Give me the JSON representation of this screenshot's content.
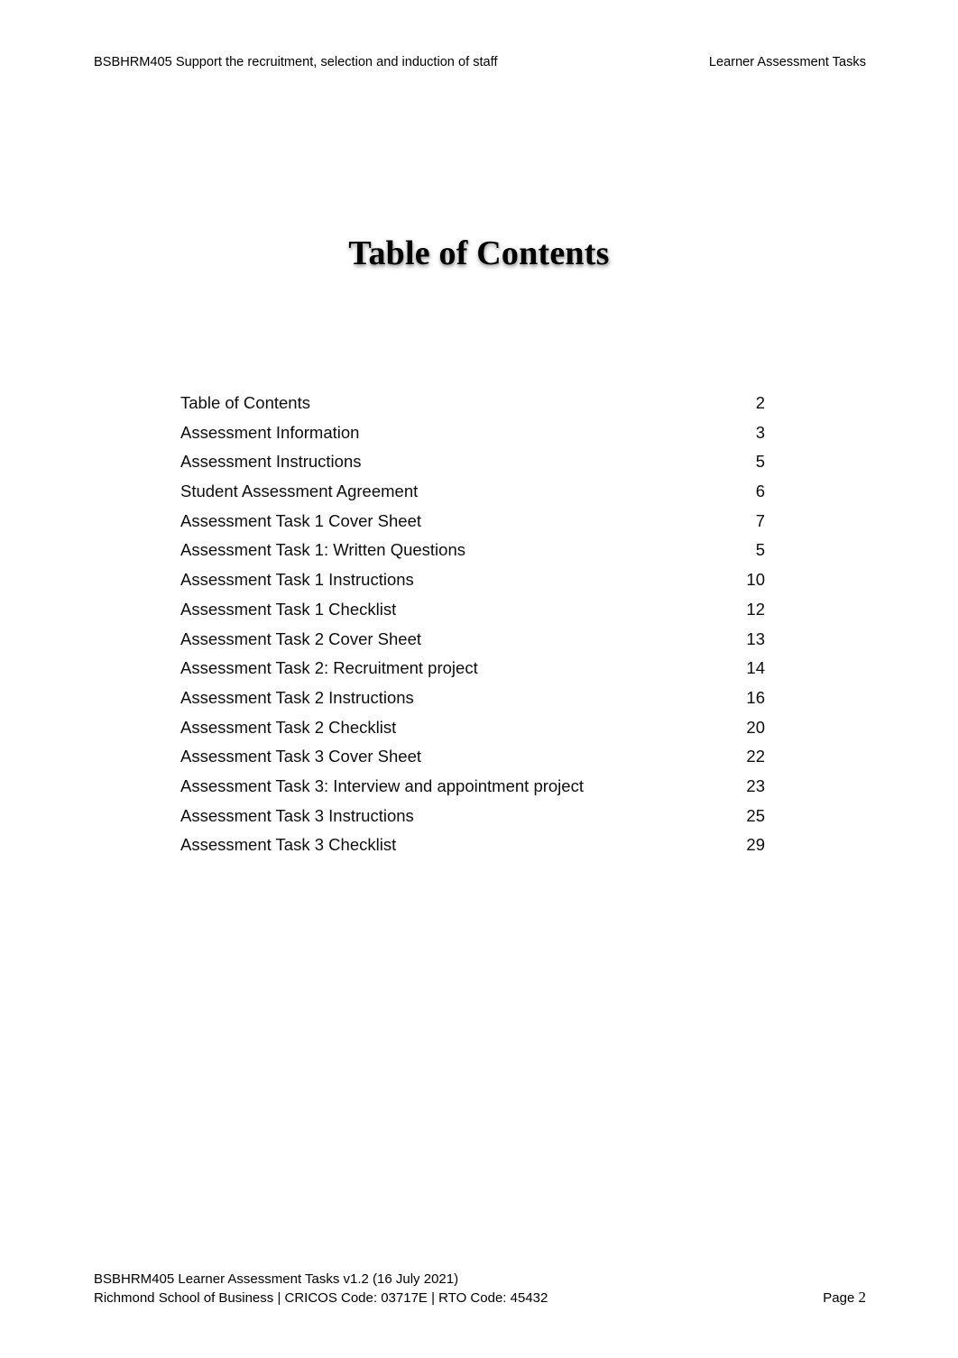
{
  "header": {
    "left": "BSBHRM405 Support the recruitment, selection and induction of staff",
    "right": "Learner Assessment Tasks"
  },
  "title": "Table of Contents",
  "toc": {
    "entries": [
      {
        "label": "Table of Contents",
        "page": "2"
      },
      {
        "label": "Assessment Information",
        "page": "3"
      },
      {
        "label": "Assessment Instructions",
        "page": "5"
      },
      {
        "label": "Student Assessment Agreement",
        "page": "6"
      },
      {
        "label": "Assessment Task 1 Cover Sheet",
        "page": "7"
      },
      {
        "label": "Assessment Task 1: Written Questions",
        "page": "5"
      },
      {
        "label": "Assessment Task 1 Instructions",
        "page": "10"
      },
      {
        "label": "Assessment Task 1 Checklist",
        "page": "12"
      },
      {
        "label": "Assessment Task 2 Cover Sheet",
        "page": "13"
      },
      {
        "label": "Assessment Task 2: Recruitment project",
        "page": "14"
      },
      {
        "label": "Assessment Task 2 Instructions",
        "page": "16"
      },
      {
        "label": "Assessment Task 2 Checklist",
        "page": "20"
      },
      {
        "label": "Assessment Task 3 Cover Sheet",
        "page": "22"
      },
      {
        "label": "Assessment Task 3: Interview and appointment project",
        "page": "23"
      },
      {
        "label": "Assessment Task 3 Instructions",
        "page": "25"
      },
      {
        "label": "Assessment Task 3 Checklist",
        "page": "29"
      }
    ]
  },
  "footer": {
    "line1": "BSBHRM405 Learner Assessment Tasks v1.2 (16 July 2021)",
    "line2": "Richmond School of Business | CRICOS Code: 03717E | RTO Code: 45432",
    "page_label": "Page",
    "page_number": "2"
  }
}
